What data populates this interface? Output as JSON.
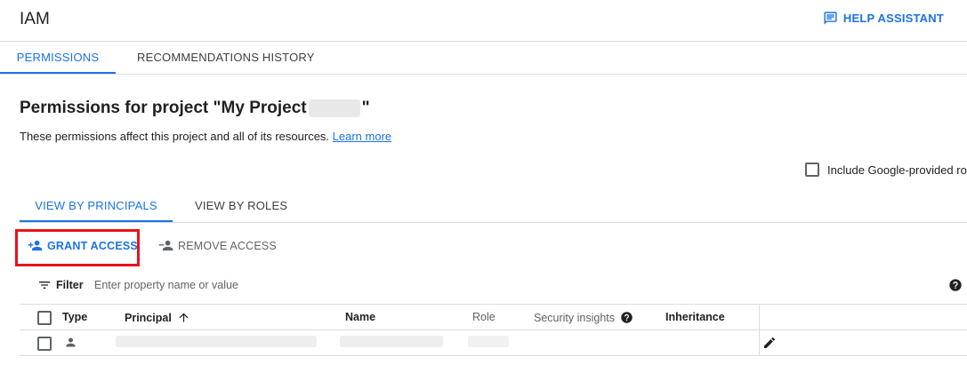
{
  "header": {
    "title": "IAM",
    "help_label": "HELP ASSISTANT"
  },
  "main_tabs": [
    {
      "label": "PERMISSIONS",
      "active": true
    },
    {
      "label": "RECOMMENDATIONS HISTORY",
      "active": false
    }
  ],
  "content": {
    "title_prefix": "Permissions for project \"My Project ",
    "title_suffix": "\"",
    "description": "These permissions affect this project and all of its resources.",
    "learn_more": "Learn more",
    "include_label": "Include Google-provided rol"
  },
  "sub_tabs": [
    {
      "label": "VIEW BY PRINCIPALS",
      "active": true
    },
    {
      "label": "VIEW BY ROLES",
      "active": false
    }
  ],
  "actions": {
    "grant": "GRANT ACCESS",
    "remove": "REMOVE ACCESS"
  },
  "filter": {
    "label": "Filter",
    "placeholder": "Enter property name or value"
  },
  "table": {
    "headers": {
      "type": "Type",
      "principal": "Principal",
      "name": "Name",
      "role": "Role",
      "security": "Security insights",
      "inheritance": "Inheritance"
    }
  },
  "colors": {
    "accent": "#1a73e8",
    "highlight_box": "#e8121c"
  }
}
